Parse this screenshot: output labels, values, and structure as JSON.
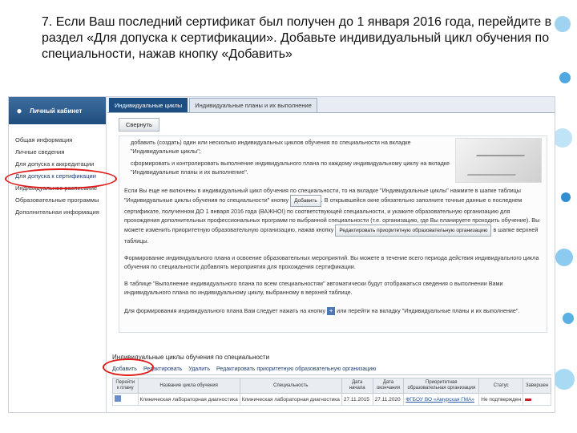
{
  "slide": {
    "title": "7. Если Ваш последний сертификат был получен до 1 января 2016 года, перейдите в раздел «Для допуска к сертификации». Добавьте индивидуальный цикл обучения по специальности, нажав кнопку «Добавить»"
  },
  "sidebar": {
    "header": "Личный кабинет",
    "items": [
      {
        "label": "Общая информация"
      },
      {
        "label": "Личные сведения"
      },
      {
        "label": "Для допуска к аккредитации"
      },
      {
        "label": "Для допуска к сертификации"
      },
      {
        "label": "Индивидуальное расписание"
      },
      {
        "label": "Образовательные программы"
      },
      {
        "label": "Дополнительная информация"
      }
    ]
  },
  "tabs": [
    {
      "label": "Индивидуальные циклы"
    },
    {
      "label": "Индивидуальные планы и их выполнение"
    }
  ],
  "collapse_label": "Свернуть",
  "info": {
    "p1": "добавить (создать) один или несколько индивидуальных циклов обучения по специальности на вкладке \"Индивидуальные циклы\";",
    "p2": "сформировать и контролировать выполнение индивидуального плана по каждому индивидуальному циклу на вкладке \"Индивидуальные планы и их выполнение\".",
    "p3a": "Если Вы еще не включены в индивидуальный цикл обучения по специальности, то на вкладке \"Индивидуальные циклы\" нажмите в шапке таблицы \"Индивидуальные циклы обучения по специальности\" кнопку",
    "p3btn": "Добавить",
    "p3b": ". В открывшейся окне обязательно заполните точные данные о последнем сертификате, полученном ДО 1 января 2016 года (ВАЖНО!) по соответствующей специальности, и укажите образовательную организацию для прохождения дополнительных профессиональных программ по выбранной специальности (т.е. организацию, где Вы планируете проходить обучение). Вы можете изменить приоритетную образовательную организацию, нажав кнопку",
    "p3btn2": "Редактировать приоритетную образовательную организацию",
    "p3c": "в шапке верхней таблицы.",
    "p4": "Формирование индивидуального плана и освоение образовательных мероприятий. Вы можете в течение всего периода действия индивидуального цикла обучения по специальности добавлять мероприятия для прохождения сертификации.",
    "p5": "В таблице \"Выполнение индивидуального плана по всем специальностям\" автоматически будут отображаться сведения о выполнении Вами индивидуального плана по индивидуальному циклу, выбранному в верхней таблице.",
    "p6a": "Для формирования индивидуального плана Вам следует нажать на кнопку",
    "p6b": "или перейти на вкладку \"Индивидуальные планы и их выполнение\"."
  },
  "cycles": {
    "title": "Индивидуальные циклы обучения по специальности",
    "toolbar": {
      "add": "Добавить",
      "view": "Редактировать",
      "delete": "Удалить",
      "edit_priority": "Редактировать приоритетную образовательную организацию"
    },
    "columns": [
      "Перейти к плану",
      "Название цикла обучения",
      "Специальность",
      "Дата начала",
      "Дата окончания",
      "Приоритетная образовательная организация",
      "Статус",
      "Завершен"
    ],
    "rows": [
      {
        "name": "Клиническая лабораторная диагностика",
        "specialty": "Клиническая лабораторная диагностика",
        "start": "27.11.2015",
        "end": "27.11.2020",
        "org": "ФГБОУ ВО «Амурская ГМА»",
        "status": "Не подтвержден",
        "done": ""
      }
    ]
  }
}
